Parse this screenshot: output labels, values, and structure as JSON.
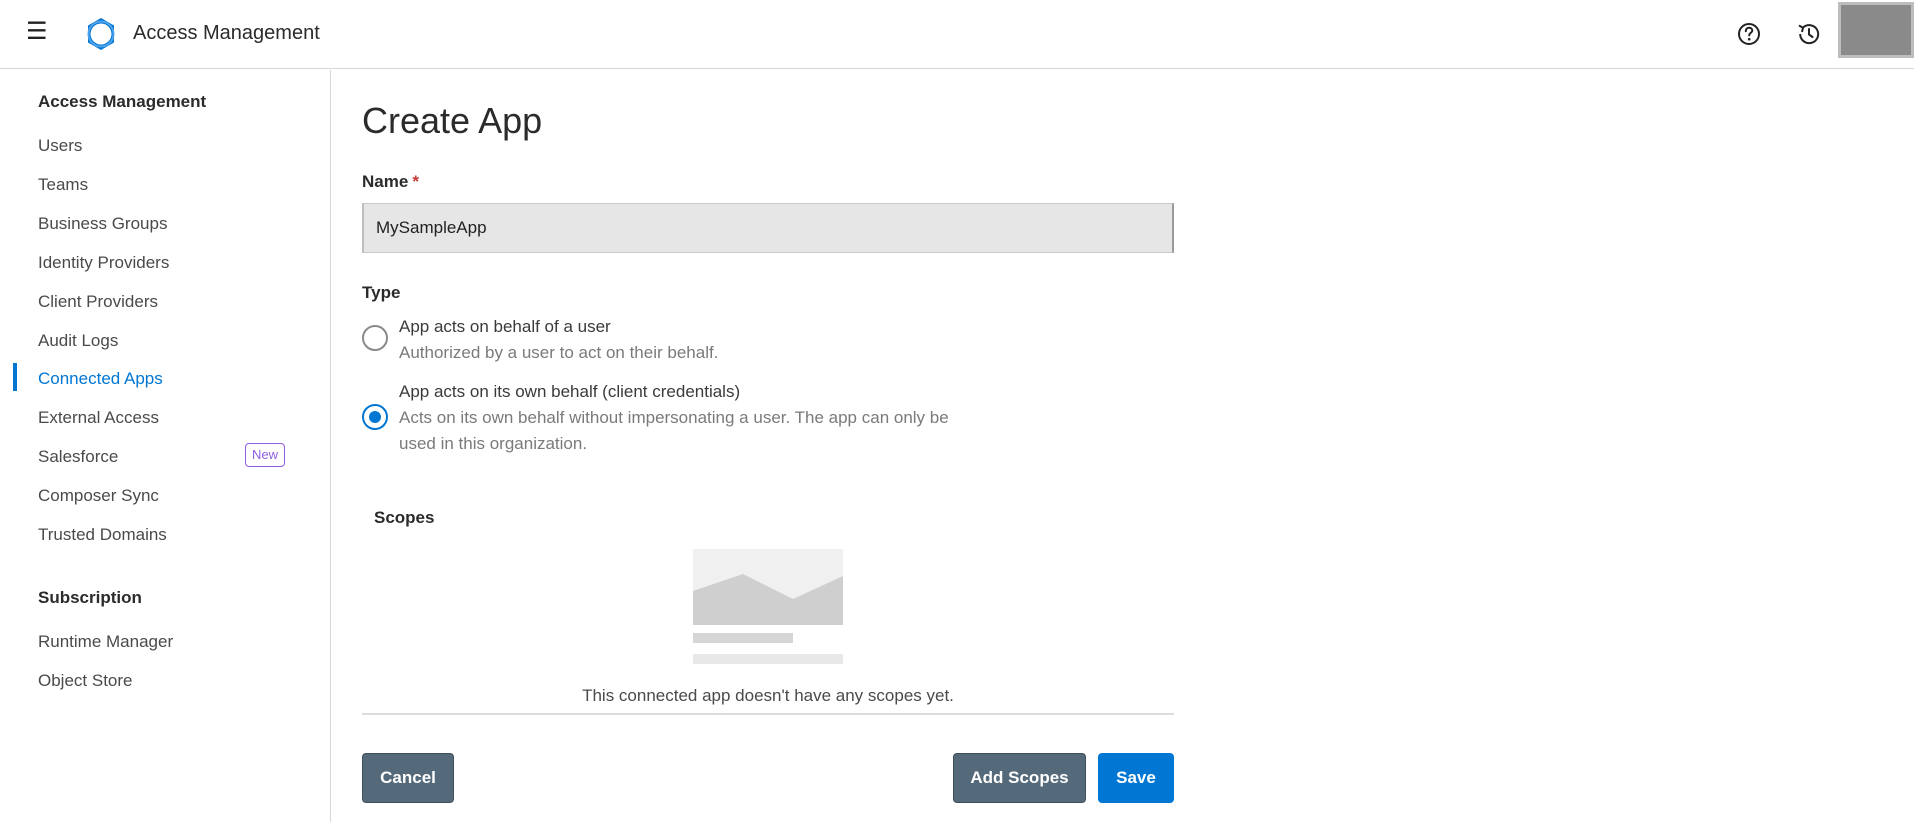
{
  "header": {
    "app_title": "Access Management",
    "menu_glyph": "☰"
  },
  "sidebar": {
    "section1_heading": "Access Management",
    "items": [
      {
        "label": "Users"
      },
      {
        "label": "Teams"
      },
      {
        "label": "Business Groups"
      },
      {
        "label": "Identity Providers"
      },
      {
        "label": "Client Providers"
      },
      {
        "label": "Audit Logs"
      },
      {
        "label": "Connected Apps"
      },
      {
        "label": "External Access"
      },
      {
        "label": "Salesforce",
        "badge": "New"
      },
      {
        "label": "Composer Sync"
      },
      {
        "label": "Trusted Domains"
      }
    ],
    "section2_heading": "Subscription",
    "items2": [
      {
        "label": "Runtime Manager"
      },
      {
        "label": "Object Store"
      }
    ]
  },
  "main": {
    "title": "Create App",
    "name_label": "Name",
    "required_mark": "*",
    "name_value": "MySampleApp",
    "type_label": "Type",
    "options": [
      {
        "title": "App acts on behalf of a user",
        "desc": "Authorized by a user to act on their behalf.",
        "checked": false
      },
      {
        "title": "App acts on its own behalf (client credentials)",
        "desc": "Acts on its own behalf without impersonating a user. The app can only be used in this organization.",
        "checked": true
      }
    ],
    "scopes_label": "Scopes",
    "empty_text": "This connected app doesn't have any scopes yet.",
    "buttons": {
      "cancel": "Cancel",
      "add_scopes": "Add Scopes",
      "save": "Save"
    }
  },
  "colors": {
    "accent": "#0176d3",
    "secondary_button": "#54697a",
    "badge": "#8e5ee6"
  }
}
